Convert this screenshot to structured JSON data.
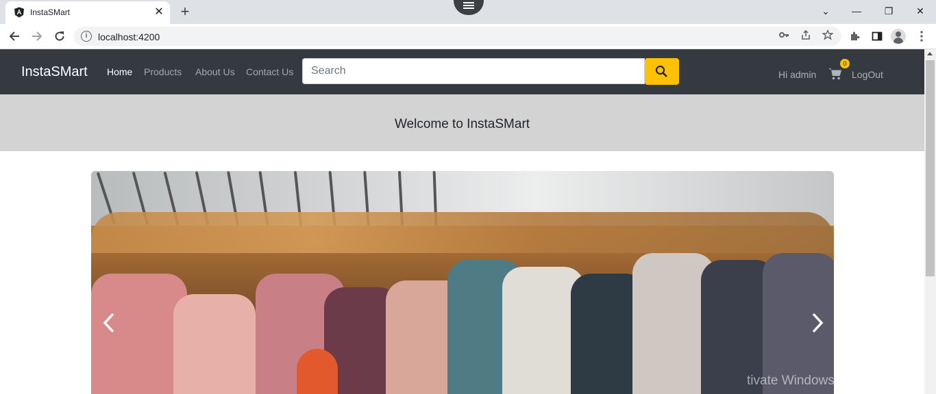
{
  "browser": {
    "tab_title": "InstaSMart",
    "url": "localhost:4200",
    "new_tab_label": "+",
    "tab_close_label": "✕",
    "window_controls": {
      "dropdown": "⌄",
      "minimize": "—",
      "restore": "❐",
      "close": "✕"
    }
  },
  "navbar": {
    "brand": "InstaSMart",
    "links": [
      {
        "label": "Home",
        "active": true
      },
      {
        "label": "Products",
        "active": false
      },
      {
        "label": "About Us",
        "active": false
      },
      {
        "label": "Contact Us",
        "active": false
      }
    ],
    "search": {
      "placeholder": "Search",
      "value": ""
    },
    "greeting": "Hi admin",
    "cart_count": "0",
    "logout_label": "LogOut"
  },
  "welcome": {
    "text": "Welcome to InstaSMart"
  },
  "carousel": {
    "prev_icon": "chevron-left-icon",
    "next_icon": "chevron-right-icon"
  },
  "overlay": {
    "watermark": "tivate Windows"
  },
  "colors": {
    "navbar_bg": "#343a40",
    "accent": "#ffc107",
    "welcome_bg": "#d3d3d3"
  }
}
